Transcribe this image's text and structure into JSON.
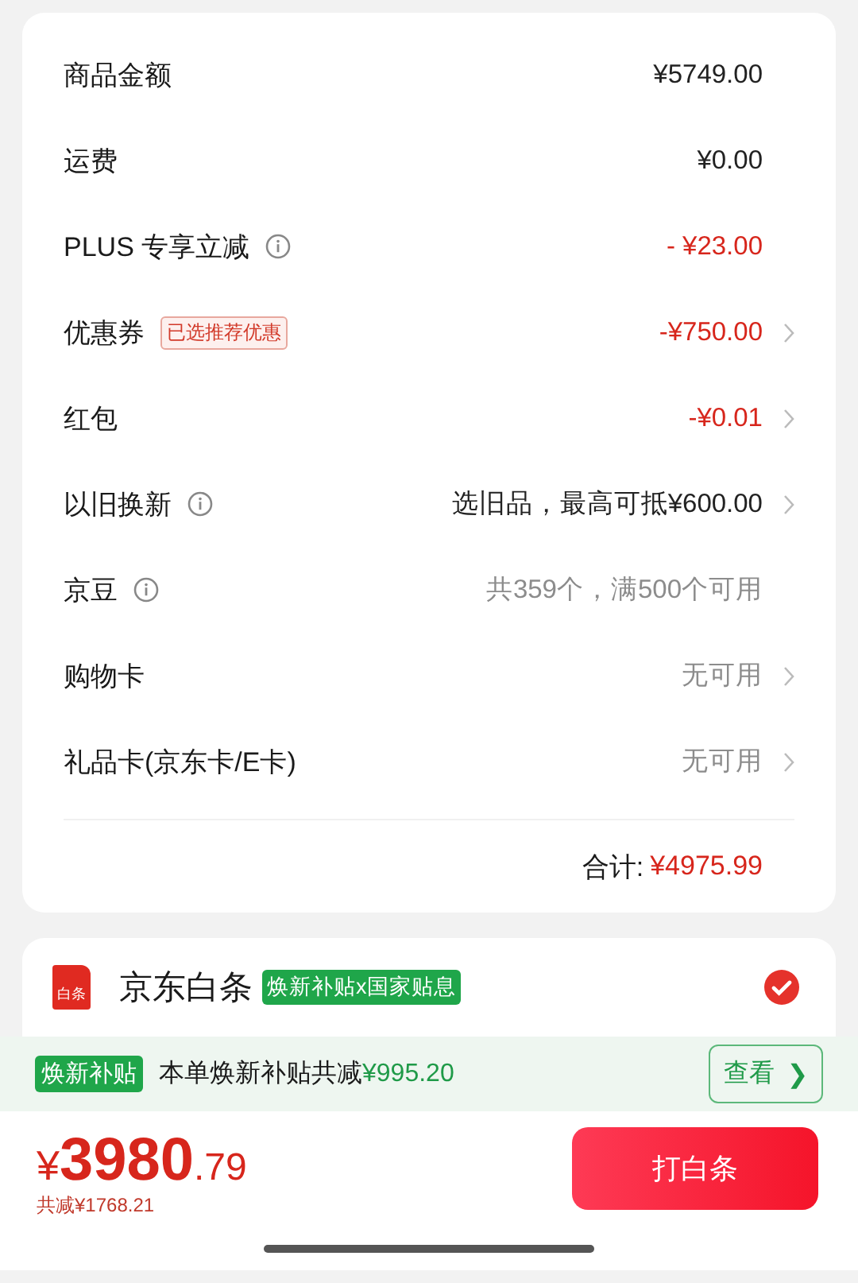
{
  "summary": {
    "rows": [
      {
        "label": "商品金额",
        "info": false,
        "value": "¥5749.00",
        "kind": "normal",
        "chevron": false
      },
      {
        "label": "运费",
        "info": false,
        "value": "¥0.00",
        "kind": "normal",
        "chevron": false
      },
      {
        "label": "PLUS 专享立减",
        "info": true,
        "value": "- ¥23.00",
        "kind": "discount",
        "chevron": false
      },
      {
        "label": "优惠券",
        "info": false,
        "tag": "已选推荐优惠",
        "value": "-¥750.00",
        "kind": "discount",
        "chevron": true
      },
      {
        "label": "红包",
        "info": false,
        "value": "-¥0.01",
        "kind": "discount",
        "chevron": true
      },
      {
        "label": "以旧换新",
        "info": true,
        "value": "选旧品，最高可抵¥600.00",
        "kind": "normal",
        "chevron": true
      },
      {
        "label": "京豆",
        "info": true,
        "value": "共359个，满500个可用",
        "kind": "muted",
        "chevron": false
      },
      {
        "label": "购物卡",
        "info": false,
        "value": "无可用",
        "kind": "muted",
        "chevron": true
      },
      {
        "label": "礼品卡(京东卡/E卡)",
        "info": false,
        "value": "无可用",
        "kind": "muted",
        "chevron": true
      }
    ],
    "total_label": "合计:",
    "total_value": "¥4975.99"
  },
  "payment": {
    "logo_text": "白条",
    "name": "京东白条",
    "tag": "焕新补贴x国家贴息",
    "selected": true
  },
  "subsidy_banner": {
    "badge": "焕新补贴",
    "text": "本单焕新补贴共减",
    "amount": "¥995.20",
    "button": "查看",
    "button_icon": "❯"
  },
  "bottom_bar": {
    "currency": "¥",
    "price_integer": "3980",
    "price_decimal": ".79",
    "savings": "共减¥1768.21",
    "pay_button": "打白条"
  }
}
